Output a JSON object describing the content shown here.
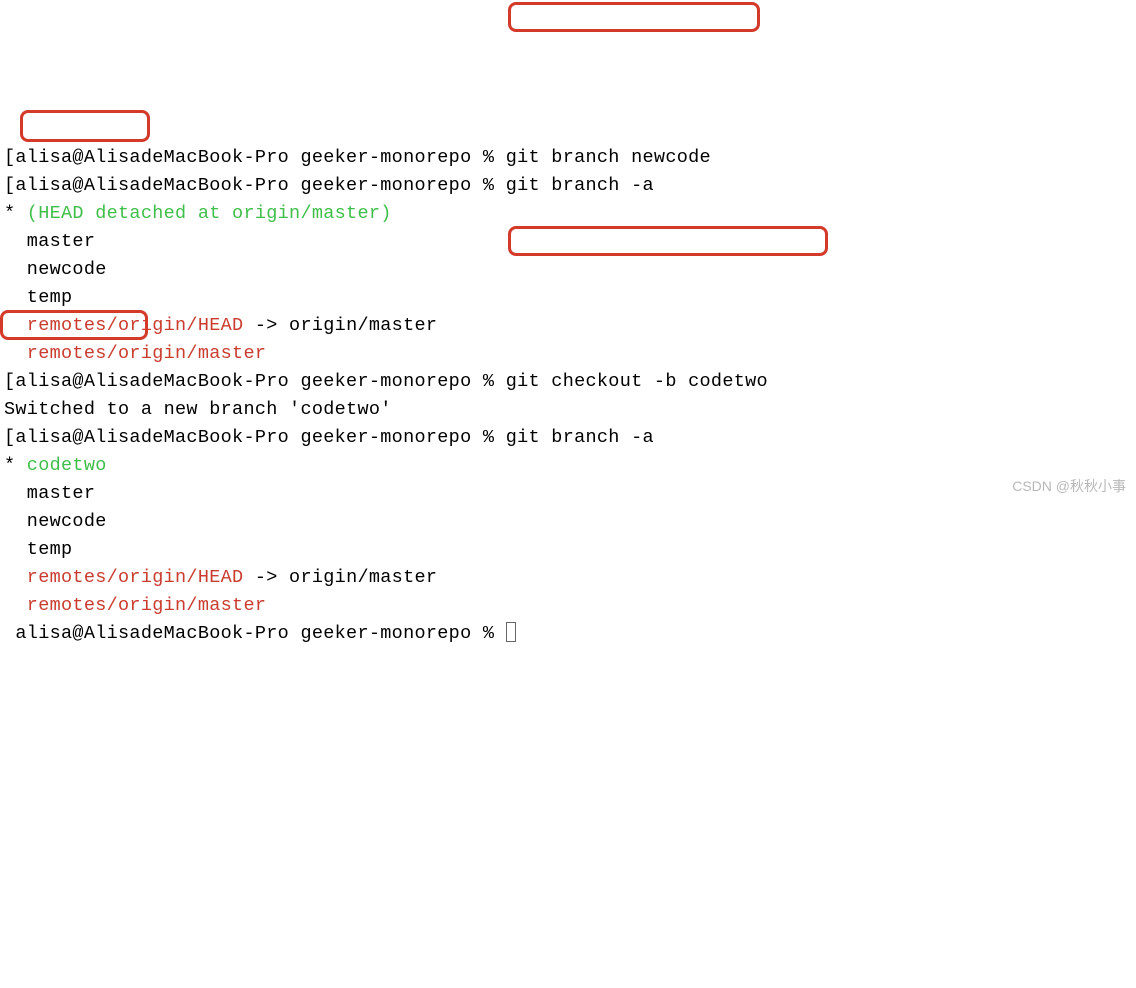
{
  "prompt_user": "alisa@AlisadeMacBook-Pro",
  "prompt_dir": "geeker-monorepo",
  "prompt_symbol": "%",
  "lines": {
    "l1_prompt": "[alisa@AlisadeMacBook-Pro geeker-monorepo % ",
    "l1_cmd": "git branch newcode",
    "l2_prompt": "[alisa@AlisadeMacBook-Pro geeker-monorepo % ",
    "l2_cmd": "git branch -a",
    "l3_star": "*",
    "l3_head": " (HEAD detached at origin/master)",
    "l4": "  master",
    "l5": "  newcode",
    "l6": "  temp",
    "l7a": "  remotes/origin/HEAD",
    "l7b": " -> origin/master",
    "l8": "  remotes/origin/master",
    "l9_prompt": "[alisa@AlisadeMacBook-Pro geeker-monorepo % ",
    "l9_cmd": "git checkout -b codetwo",
    "l10": "Switched to a new branch 'codetwo'",
    "l11_prompt": "[alisa@AlisadeMacBook-Pro geeker-monorepo % ",
    "l11_cmd": "git branch -a",
    "l12_star": "*",
    "l12_branch": " codetwo",
    "l13": "  master",
    "l14": "  newcode",
    "l15": "  temp",
    "l16a": "  remotes/origin/HEAD",
    "l16b": " -> origin/master",
    "l17": "  remotes/origin/master",
    "l18_prompt": " alisa@AlisadeMacBook-Pro geeker-monorepo % "
  },
  "watermark": "CSDN @秋秋小事"
}
